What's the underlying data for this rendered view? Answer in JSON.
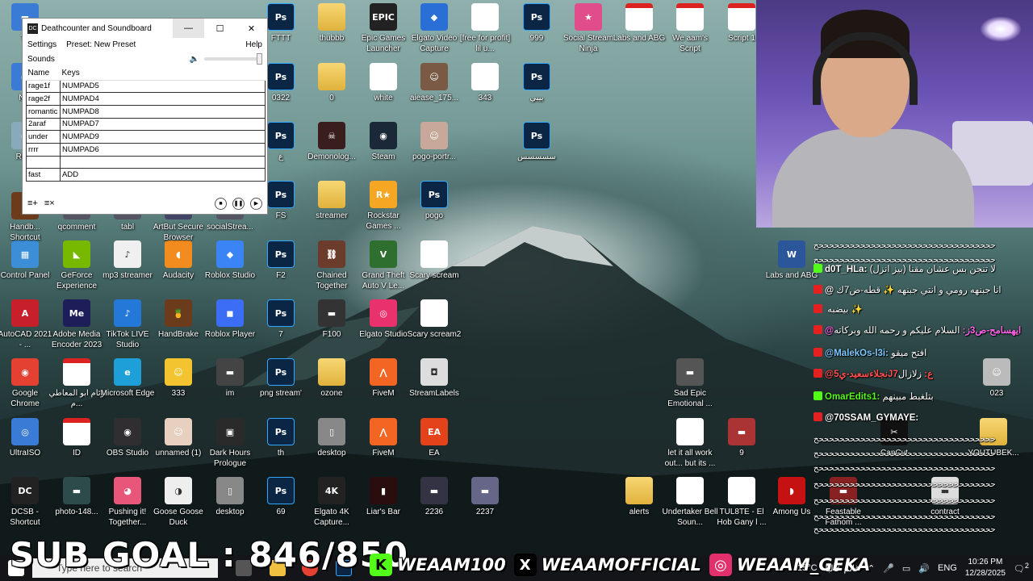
{
  "app_window": {
    "title": "Deathcounter and Soundboard",
    "logo": "DC",
    "menu": {
      "settings": "Settings",
      "preset": "Preset: New Preset",
      "help": "Help"
    },
    "sounds_label": "Sounds",
    "volume_icon": "speaker-icon",
    "columns": [
      "Name",
      "Keys"
    ],
    "rows": [
      {
        "name": "rage1f",
        "key": "NUMPAD5"
      },
      {
        "name": "rage2f",
        "key": "NUMPAD4"
      },
      {
        "name": "romantic",
        "key": "NUMPAD8"
      },
      {
        "name": "2araf",
        "key": "NUMPAD7"
      },
      {
        "name": "under",
        "key": "NUMPAD9"
      },
      {
        "name": "rrrr",
        "key": "NUMPAD6"
      },
      {
        "name": "",
        "key": ""
      },
      {
        "name": "fast",
        "key": "ADD"
      }
    ],
    "window_buttons": {
      "minimize": "—",
      "maximize": "☐",
      "close": "✕"
    }
  },
  "desktop_icons": [
    {
      "label": "FTTT",
      "type": "psd",
      "glyph": "Ps"
    },
    {
      "label": "thubbb",
      "type": "folder",
      "glyph": ""
    },
    {
      "label": "Epic Games Launcher",
      "type": "app",
      "glyph": "EPIC",
      "color": "#222"
    },
    {
      "label": "Elgato Video Capture",
      "type": "app",
      "glyph": "◆",
      "color": "#2a6fd6"
    },
    {
      "label": "[free for profit] lil u...",
      "type": "vid",
      "glyph": "▶"
    },
    {
      "label": "999",
      "type": "psd",
      "glyph": "Ps"
    },
    {
      "label": "Social Stream Ninja",
      "type": "app",
      "glyph": "★",
      "color": "#e04d8a"
    },
    {
      "label": "Labs and ABG",
      "type": "pdf",
      "glyph": "PDF"
    },
    {
      "label": "We aam's Script",
      "type": "pdf",
      "glyph": "PDF"
    },
    {
      "label": "Script 1",
      "type": "pdf",
      "glyph": "PDF"
    },
    {
      "label": "0322",
      "type": "psd",
      "glyph": "Ps"
    },
    {
      "label": "0",
      "type": "folder",
      "glyph": ""
    },
    {
      "label": "white",
      "type": "app",
      "glyph": "",
      "color": "#fff"
    },
    {
      "label": "aiease_175...",
      "type": "app",
      "glyph": "☺",
      "color": "#7a5a44"
    },
    {
      "label": "343",
      "type": "vid",
      "glyph": "▶"
    },
    {
      "label": "بيبي",
      "type": "psd",
      "glyph": "Ps"
    },
    {
      "label": "ع",
      "type": "psd",
      "glyph": "Ps"
    },
    {
      "label": "Demonolog...",
      "type": "app",
      "glyph": "☠",
      "color": "#3a1e1e"
    },
    {
      "label": "Steam",
      "type": "app",
      "glyph": "◉",
      "color": "#1b2838"
    },
    {
      "label": "pogo-portr...",
      "type": "app",
      "glyph": "☺",
      "color": "#c8a89a"
    },
    {
      "label": "سسسسس",
      "type": "psd",
      "glyph": "Ps"
    },
    {
      "label": "FS",
      "type": "psd",
      "glyph": "Ps"
    },
    {
      "label": "streamer",
      "type": "folder",
      "glyph": ""
    },
    {
      "label": "Rockstar Games ...",
      "type": "app",
      "glyph": "R★",
      "color": "#f5a623"
    },
    {
      "label": "pogo",
      "type": "psd",
      "glyph": "Ps"
    },
    {
      "label": "Control Panel",
      "type": "app",
      "glyph": "▦",
      "color": "#3c8ed6"
    },
    {
      "label": "GeForce Experience",
      "type": "app",
      "glyph": "◣",
      "color": "#76b900"
    },
    {
      "label": "mp3 streamer",
      "type": "app",
      "glyph": "♪",
      "color": "#f0f0f0"
    },
    {
      "label": "Audacity",
      "type": "app",
      "glyph": "◖",
      "color": "#f28c1e"
    },
    {
      "label": "Roblox Studio",
      "type": "app",
      "glyph": "◆",
      "color": "#3b84f5"
    },
    {
      "label": "F2",
      "type": "psd",
      "glyph": "Ps"
    },
    {
      "label": "Chained Together",
      "type": "app",
      "glyph": "⛓",
      "color": "#6b3b2b"
    },
    {
      "label": "Grand Theft Auto V Le...",
      "type": "app",
      "glyph": "V",
      "color": "#2e6e2e"
    },
    {
      "label": "Scary scream",
      "type": "vid",
      "glyph": "▶"
    },
    {
      "label": "AutoCAD 2021 - ...",
      "type": "app",
      "glyph": "A",
      "color": "#c8202a"
    },
    {
      "label": "Adobe Media Encoder 2023",
      "type": "app",
      "glyph": "Me",
      "color": "#1d1d5a"
    },
    {
      "label": "TikTok LIVE Studio",
      "type": "app",
      "glyph": "♪",
      "color": "#2479d8"
    },
    {
      "label": "HandBrake",
      "type": "app",
      "glyph": "🍍",
      "color": "#6b3b1b"
    },
    {
      "label": "Roblox Player",
      "type": "app",
      "glyph": "◼",
      "color": "#3b6ef5"
    },
    {
      "label": "7",
      "type": "psd",
      "glyph": "Ps"
    },
    {
      "label": "F100",
      "type": "app",
      "glyph": "▬",
      "color": "#333"
    },
    {
      "label": "Elgato Studio",
      "type": "app",
      "glyph": "◎",
      "color": "#e8316d"
    },
    {
      "label": "Scary scream2",
      "type": "vid",
      "glyph": "▶"
    },
    {
      "label": "Google Chrome",
      "type": "app",
      "glyph": "◉",
      "color": "#e44133"
    },
    {
      "label": "وئام ابو المعاطي م...",
      "type": "pdf",
      "glyph": "PDF"
    },
    {
      "label": "Microsoft Edge",
      "type": "app",
      "glyph": "e",
      "color": "#1f9fd8"
    },
    {
      "label": "333",
      "type": "app",
      "glyph": "☺",
      "color": "#f4c430"
    },
    {
      "label": "im",
      "type": "app",
      "glyph": "▬",
      "color": "#444"
    },
    {
      "label": "png stream'",
      "type": "psd",
      "glyph": "Ps"
    },
    {
      "label": "ozone",
      "type": "folder",
      "glyph": ""
    },
    {
      "label": "FiveM",
      "type": "app",
      "glyph": "⋀",
      "color": "#f26522"
    },
    {
      "label": "StreamLabels",
      "type": "app",
      "glyph": "◘",
      "color": "#ddd"
    },
    {
      "label": "Sad Epic Emotional ...",
      "type": "app",
      "glyph": "▬",
      "color": "#555"
    },
    {
      "label": "UltraISO",
      "type": "app",
      "glyph": "◎",
      "color": "#3a7bd5"
    },
    {
      "label": "ID",
      "type": "pdf",
      "glyph": "PDF"
    },
    {
      "label": "OBS Studio",
      "type": "app",
      "glyph": "◉",
      "color": "#302e31"
    },
    {
      "label": "unnamed (1)",
      "type": "app",
      "glyph": "☺",
      "color": "#e8d0c0"
    },
    {
      "label": "Dark Hours Prologue",
      "type": "app",
      "glyph": "▣",
      "color": "#2a2a2a"
    },
    {
      "label": "th",
      "type": "psd",
      "glyph": "Ps"
    },
    {
      "label": "desktop",
      "type": "app",
      "glyph": "▯",
      "color": "#888"
    },
    {
      "label": "FiveM",
      "type": "app",
      "glyph": "⋀",
      "color": "#f26522"
    },
    {
      "label": "EA",
      "type": "app",
      "glyph": "EA",
      "color": "#e4421a"
    },
    {
      "label": "let it all work out... but its ...",
      "type": "vid",
      "glyph": "▶"
    },
    {
      "label": "9",
      "type": "app",
      "glyph": "▬",
      "color": "#a33"
    },
    {
      "label": "DCSB - Shortcut",
      "type": "app",
      "glyph": "DC",
      "color": "#222"
    },
    {
      "label": "photo-148...",
      "type": "app",
      "glyph": "▬",
      "color": "#2d4b4b"
    },
    {
      "label": "Pushing it! Together...",
      "type": "app",
      "glyph": "◕",
      "color": "#e8567a"
    },
    {
      "label": "Goose Goose Duck",
      "type": "app",
      "glyph": "◑",
      "color": "#eee"
    },
    {
      "label": "desktop",
      "type": "app",
      "glyph": "▯",
      "color": "#888"
    },
    {
      "label": "69",
      "type": "psd",
      "glyph": "Ps"
    },
    {
      "label": "Elgato 4K Capture...",
      "type": "app",
      "glyph": "4K",
      "color": "#222"
    },
    {
      "label": "Liar's Bar",
      "type": "app",
      "glyph": "▮",
      "color": "#2a0d0d"
    },
    {
      "label": "2236",
      "type": "app",
      "glyph": "▬",
      "color": "#334"
    },
    {
      "label": "2237",
      "type": "app",
      "glyph": "▬",
      "color": "#668"
    },
    {
      "label": "alerts",
      "type": "folder",
      "glyph": ""
    },
    {
      "label": "Undertaker Bell Soun...",
      "type": "vid",
      "glyph": "▶"
    },
    {
      "label": "TUL8TE - El Hob Gany l ...",
      "type": "vid",
      "glyph": "▶"
    },
    {
      "label": "Among Us",
      "type": "app",
      "glyph": "◗",
      "color": "#c51111"
    },
    {
      "label": "Handb... Shortcut",
      "type": "app",
      "glyph": "🍍",
      "color": "#6b3b1b"
    },
    {
      "label": "qcomment",
      "type": "app",
      "glyph": "▬",
      "color": "#556"
    },
    {
      "label": "tabl",
      "type": "app",
      "glyph": "▬",
      "color": "#556"
    },
    {
      "label": "ArtBut Secure Browser",
      "type": "app",
      "glyph": "▬",
      "color": "#446"
    },
    {
      "label": "socialStrea...",
      "type": "app",
      "glyph": "▬",
      "color": "#556"
    },
    {
      "label": "Th",
      "type": "app",
      "glyph": "▬",
      "color": "#3a7bd5"
    },
    {
      "label": "Net",
      "type": "app",
      "glyph": "▬",
      "color": "#3a7bd5"
    },
    {
      "label": "Recy",
      "type": "app",
      "glyph": "▬",
      "color": "#8ab"
    },
    {
      "label": "Labs and ABG",
      "type": "app",
      "glyph": "W",
      "color": "#2b579a"
    },
    {
      "label": "023",
      "type": "app",
      "glyph": "☺",
      "color": "#bbb"
    },
    {
      "label": "CapCut",
      "type": "app",
      "glyph": "✂",
      "color": "#111"
    },
    {
      "label": "YOUTUBEK...",
      "type": "folder",
      "glyph": ""
    },
    {
      "label": "Feastable Fathom ...",
      "type": "app",
      "glyph": "▬",
      "color": "#822"
    },
    {
      "label": "contract",
      "type": "app",
      "glyph": "▬",
      "color": "#ddd"
    }
  ],
  "webcam": {
    "description_icon": "webcam-feed-icon"
  },
  "chat": {
    "divider": "ححححححححححححححححححححححححححححححححححح",
    "messages": [
      {
        "platform": "kick",
        "user": "d0T_HLa:",
        "text": "لا تنجن بس عشان مقنا (بيز انزل)",
        "color": "#ffffff"
      },
      {
        "platform": "yt",
        "user": "@",
        "text": "انا جبنهه رومي و انتي جبنهه ✨ قطه-ض7ك",
        "color": "#ffffff"
      },
      {
        "platform": "yt",
        "user": "",
        "text": "بيضبه ✨",
        "color": "#ffffff"
      },
      {
        "platform": "yt",
        "user": "@ايهسامح-ص3ز:",
        "text": "السلام عليكم و رحمه الله وبركاته",
        "color": "#ff63e9"
      },
      {
        "platform": "yt",
        "user": "@MalekOs-l3i:",
        "text": "افتح ميقو",
        "color": "#7ec8ff"
      },
      {
        "platform": "yt",
        "user": "@نجلاءسعيد-ي5J7ع:",
        "text": "زلازال",
        "color": "#ff5050"
      },
      {
        "platform": "kick",
        "user": "OmarEdits1:",
        "text": "بتلغبط مبينهم",
        "color": "#53fc18"
      },
      {
        "platform": "yt",
        "user": "@70SSAM_GYMAYE:",
        "text": "",
        "color": "#ffffff"
      }
    ]
  },
  "overlay": {
    "sub_goal": "SUB GOAL : 846/850",
    "socials": [
      {
        "icon": "kick-icon",
        "glyph": "K",
        "bg": "#53fc18",
        "handle": "WEAAM100"
      },
      {
        "icon": "x-icon",
        "glyph": "X",
        "bg": "#000000",
        "handle": "WEAAMOFFICIAL"
      },
      {
        "icon": "instagram-icon",
        "glyph": "◎",
        "bg": "#e1306c",
        "handle": "WEAAM_GEKA"
      }
    ]
  },
  "taskbar": {
    "search_placeholder": "Type here to search",
    "weather": "15°C",
    "weather_desc": "غائم عالبًا",
    "lang": "ENG",
    "time": "10:26 PM",
    "date": "12/28/2025",
    "notif_badge": "2"
  }
}
